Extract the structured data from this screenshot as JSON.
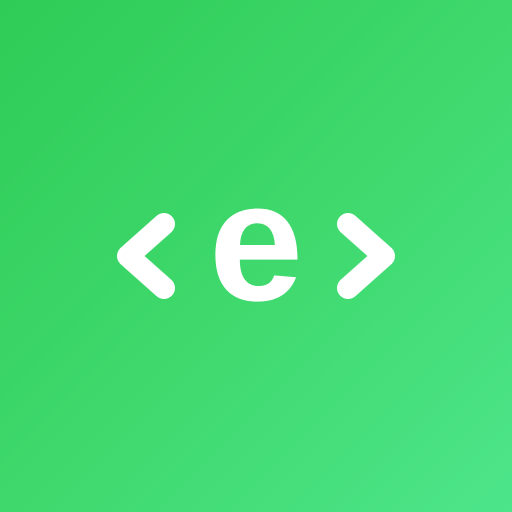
{
  "logo": {
    "letter": "e",
    "background_start": "#2fcc57",
    "background_end": "#4de58a",
    "foreground": "#ffffff",
    "icons": [
      "chevron-left-icon",
      "letter-e-mark",
      "chevron-right-icon"
    ]
  }
}
